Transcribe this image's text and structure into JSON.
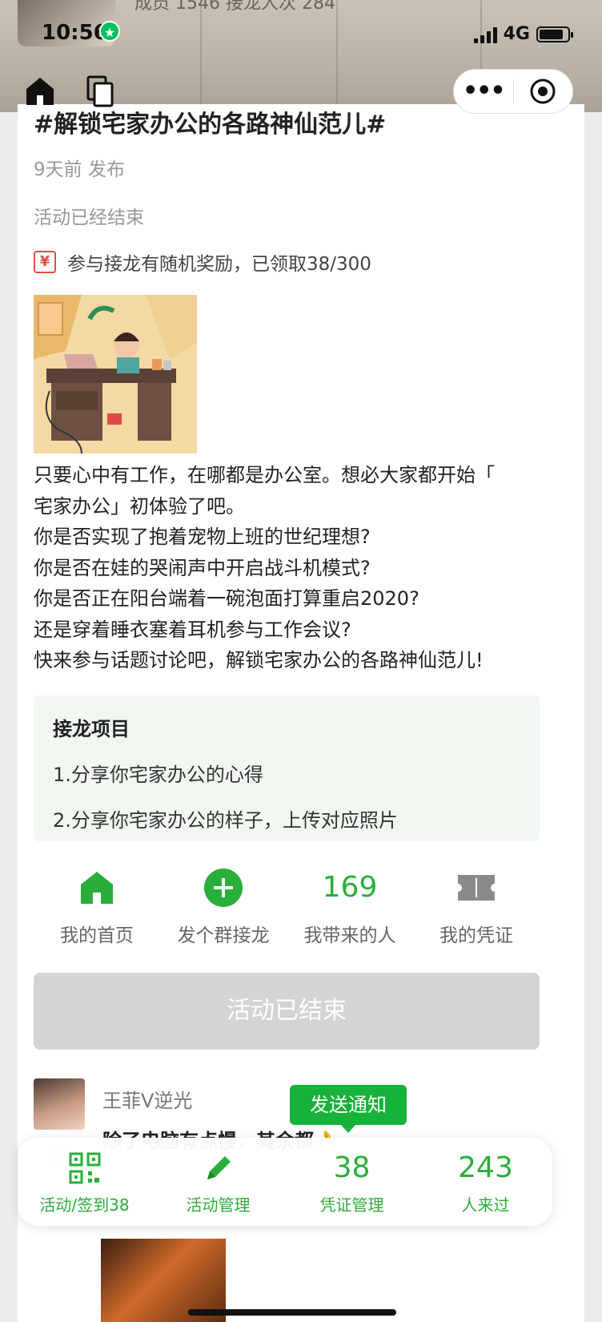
{
  "status_bar": {
    "time": "10:56",
    "network": "4G",
    "top_caption": "成员 1546  接龙人次 284",
    "battery_level": 0.85
  },
  "nav": {
    "home_icon": "home-icon",
    "copy_icon": "pages-icon",
    "more_icon": "more-dots-icon",
    "close_icon": "target-icon"
  },
  "post": {
    "title": "#解锁宅家办公的各路神仙范儿#",
    "published": "9天前 发布",
    "status": "活动已经结束",
    "reward_icon_text": "¥",
    "reward_text": "参与接龙有随机奖励，已领取38/300",
    "description_lines": [
      "只要心中有工作，在哪都是办公室。想必大家都开始「",
      "宅家办公」初体验了吧。",
      "你是否实现了抱着宠物上班的世纪理想?",
      "你是否在娃的哭闹声中开启战斗机模式?",
      "你是否正在阳台端着一碗泡面打算重启2020?",
      "还是穿着睡衣塞着耳机参与工作会议?",
      "快来参与话题讨论吧，解锁宅家办公的各路神仙范儿!"
    ]
  },
  "project": {
    "title": "接龙项目",
    "items": [
      "1.分享你宅家办公的心得",
      "2.分享你宅家办公的样子，上传对应照片"
    ]
  },
  "quick_actions": [
    {
      "label": "我的首页",
      "icon": "home-icon"
    },
    {
      "label": "发个群接龙",
      "icon": "plus-circle-icon"
    },
    {
      "label": "我带来的人",
      "value": "169"
    },
    {
      "label": "我的凭证",
      "icon": "ticket-icon"
    }
  ],
  "ended_button": "活动已结束",
  "comment": {
    "name": "王菲V逆光",
    "text": "除了电脑有点慢，其余都👌",
    "faint_count": "38"
  },
  "notify_button": "发送通知",
  "bottom_bar": [
    {
      "label": "活动/签到38",
      "icon": "qrcode-icon"
    },
    {
      "label": "活动管理",
      "icon": "pencil-icon"
    },
    {
      "label": "凭证管理",
      "value": "38"
    },
    {
      "label": "人来过",
      "value": "243"
    }
  ],
  "colors": {
    "accent": "#2aae3a",
    "notify_bg": "#16b239",
    "ended_bg": "#d4d4d4",
    "project_bg": "#f1f8f1",
    "reward_red": "#e54d42"
  }
}
